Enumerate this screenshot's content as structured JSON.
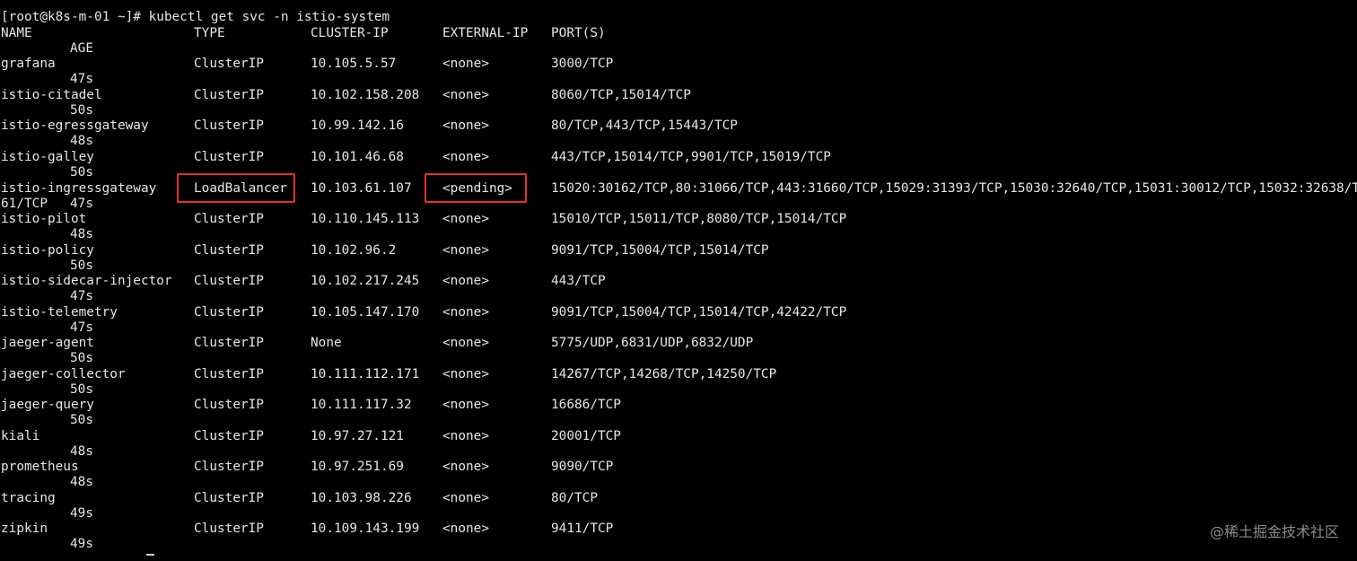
{
  "terminal": {
    "prompt": "[root@k8s-m-01 ~]# kubectl get svc -n istio-system",
    "headers": {
      "name": "NAME",
      "type": "TYPE",
      "cluster_ip": "CLUSTER-IP",
      "external_ip": "EXTERNAL-IP",
      "ports": "PORT(S)",
      "age": "AGE"
    },
    "services": [
      {
        "name": "grafana",
        "type": "ClusterIP",
        "cluster_ip": "10.105.5.57",
        "external_ip": "<none>",
        "ports": "3000/TCP",
        "age": "47s"
      },
      {
        "name": "istio-citadel",
        "type": "ClusterIP",
        "cluster_ip": "10.102.158.208",
        "external_ip": "<none>",
        "ports": "8060/TCP,15014/TCP",
        "age": "50s"
      },
      {
        "name": "istio-egressgateway",
        "type": "ClusterIP",
        "cluster_ip": "10.99.142.16",
        "external_ip": "<none>",
        "ports": "80/TCP,443/TCP,15443/TCP",
        "age": "48s"
      },
      {
        "name": "istio-galley",
        "type": "ClusterIP",
        "cluster_ip": "10.101.46.68",
        "external_ip": "<none>",
        "ports": "443/TCP,15014/TCP,9901/TCP,15019/TCP",
        "age": "50s"
      },
      {
        "name": "istio-ingressgateway",
        "type": "LoadBalancer",
        "cluster_ip": "10.103.61.107",
        "external_ip": "<pending>",
        "ports": "15020:30162/TCP,80:31066/TCP,443:31660/TCP,15029:31393/TCP,15030:32640/TCP,15031:30012/TCP,15032:32638/T",
        "ports_wrap": "61/TCP",
        "age": "47s"
      },
      {
        "name": "istio-pilot",
        "type": "ClusterIP",
        "cluster_ip": "10.110.145.113",
        "external_ip": "<none>",
        "ports": "15010/TCP,15011/TCP,8080/TCP,15014/TCP",
        "age": "48s"
      },
      {
        "name": "istio-policy",
        "type": "ClusterIP",
        "cluster_ip": "10.102.96.2",
        "external_ip": "<none>",
        "ports": "9091/TCP,15004/TCP,15014/TCP",
        "age": "50s"
      },
      {
        "name": "istio-sidecar-injector",
        "type": "ClusterIP",
        "cluster_ip": "10.102.217.245",
        "external_ip": "<none>",
        "ports": "443/TCP",
        "age": "47s"
      },
      {
        "name": "istio-telemetry",
        "type": "ClusterIP",
        "cluster_ip": "10.105.147.170",
        "external_ip": "<none>",
        "ports": "9091/TCP,15004/TCP,15014/TCP,42422/TCP",
        "age": "47s"
      },
      {
        "name": "jaeger-agent",
        "type": "ClusterIP",
        "cluster_ip": "None",
        "external_ip": "<none>",
        "ports": "5775/UDP,6831/UDP,6832/UDP",
        "age": "50s"
      },
      {
        "name": "jaeger-collector",
        "type": "ClusterIP",
        "cluster_ip": "10.111.112.171",
        "external_ip": "<none>",
        "ports": "14267/TCP,14268/TCP,14250/TCP",
        "age": "50s"
      },
      {
        "name": "jaeger-query",
        "type": "ClusterIP",
        "cluster_ip": "10.111.117.32",
        "external_ip": "<none>",
        "ports": "16686/TCP",
        "age": "50s"
      },
      {
        "name": "kiali",
        "type": "ClusterIP",
        "cluster_ip": "10.97.27.121",
        "external_ip": "<none>",
        "ports": "20001/TCP",
        "age": "48s"
      },
      {
        "name": "prometheus",
        "type": "ClusterIP",
        "cluster_ip": "10.97.251.69",
        "external_ip": "<none>",
        "ports": "9090/TCP",
        "age": "48s"
      },
      {
        "name": "tracing",
        "type": "ClusterIP",
        "cluster_ip": "10.103.98.226",
        "external_ip": "<none>",
        "ports": "80/TCP",
        "age": "49s"
      },
      {
        "name": "zipkin",
        "type": "ClusterIP",
        "cluster_ip": "10.109.143.199",
        "external_ip": "<none>",
        "ports": "9411/TCP",
        "age": "49s"
      }
    ]
  },
  "watermark": "@稀土掘金技术社区",
  "colors": {
    "background": "#000000",
    "text": "#e6e6e6",
    "highlight": "#e0322f",
    "watermark": "#8c8c8c"
  }
}
